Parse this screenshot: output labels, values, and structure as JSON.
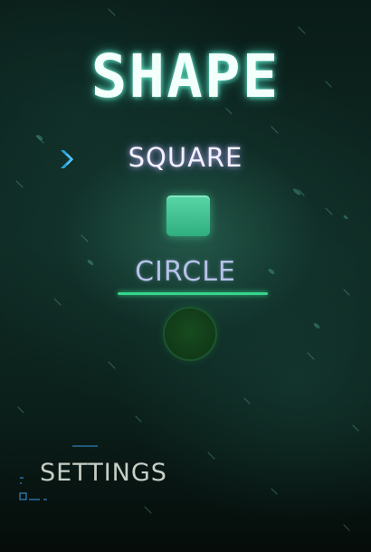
{
  "title": "SHAPE",
  "menu": {
    "options": [
      {
        "label": "SQUARE",
        "selected": true,
        "shape": "square",
        "color": "#4cc99a"
      },
      {
        "label": "CIRCLE",
        "selected": false,
        "shape": "circle",
        "color": "#154a1c"
      }
    ],
    "cursor_icon": "chevron-right-icon",
    "active_underline_color": "#35d58c"
  },
  "settings": {
    "label": "SETTINGS"
  },
  "colors": {
    "background": "#0f2a24",
    "title_glow": "#78ffe1",
    "cursor": "#3ab8f0"
  }
}
